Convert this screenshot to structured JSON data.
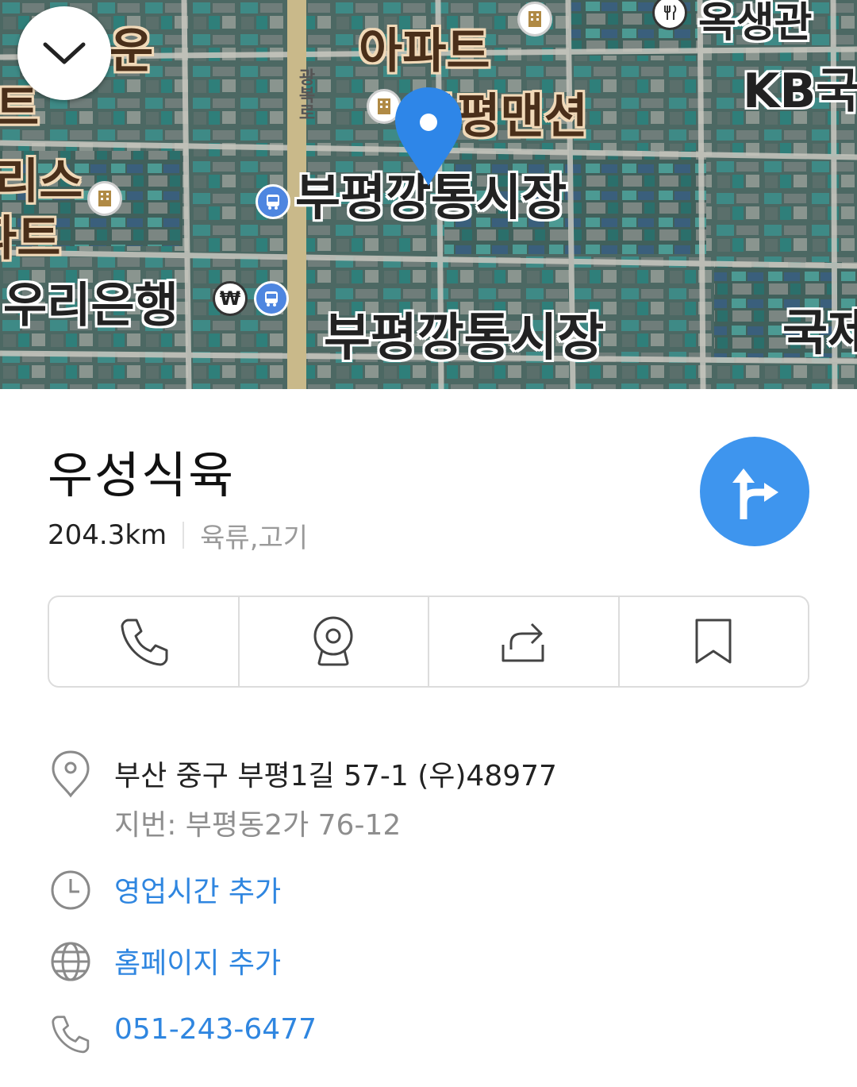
{
  "map": {
    "labels": {
      "apartment_1": "아파트",
      "okseong": "옥생관",
      "kb_bank": "KB국",
      "bupyeong_mansion": "부평맨션",
      "market_upper": "부평깡통시장",
      "woori_bank": "우리은행",
      "market_lower": "부평깡통시장",
      "gukje": "국제",
      "road_name": "광복로",
      "left_un": "운",
      "left_teu": "트",
      "left_riseu": "리스",
      "left_pateu": "파트"
    }
  },
  "place": {
    "name": "우성식육",
    "distance": "204.3km",
    "category": "육류,고기"
  },
  "actions": [
    {
      "icon": "phone-icon"
    },
    {
      "icon": "roadview-icon"
    },
    {
      "icon": "share-icon"
    },
    {
      "icon": "bookmark-icon"
    }
  ],
  "info": {
    "address": "부산 중구 부평1길 57-1 (우)48977",
    "jibun": "지번: 부평동2가 76-12",
    "hours_link": "영업시간 추가",
    "homepage_link": "홈페이지 추가",
    "phone": "051-243-6477"
  },
  "colors": {
    "accent": "#3e95ee",
    "link": "#2f86e0",
    "pin": "#2e86e8"
  }
}
